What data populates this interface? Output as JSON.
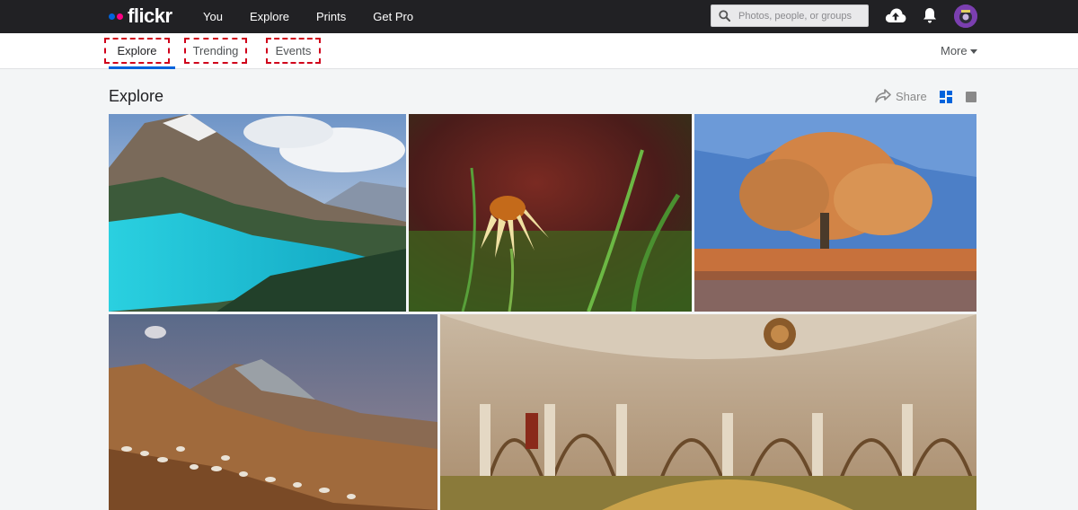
{
  "topnav": {
    "logo_text": "flickr",
    "links": [
      "You",
      "Explore",
      "Prints",
      "Get Pro"
    ],
    "search_placeholder": "Photos, people, or groups"
  },
  "subnav": {
    "tabs": [
      "Explore",
      "Trending",
      "Events"
    ],
    "active_tab": "Explore",
    "more_label": "More",
    "highlight_color": "#d0021b",
    "active_underline_color": "#0063dc"
  },
  "page": {
    "title": "Explore",
    "share_label": "Share"
  },
  "brand_colors": {
    "blue_dot": "#0063dc",
    "pink_dot": "#ff0084",
    "topbar": "#212124"
  },
  "icons": [
    "search-icon",
    "upload-cloud-icon",
    "bell-icon",
    "share-arrow-icon",
    "grid-view-icon",
    "single-view-icon"
  ]
}
